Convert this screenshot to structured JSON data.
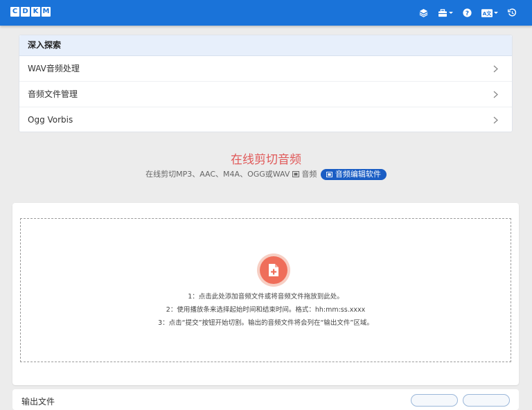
{
  "brand": {
    "letters": [
      "C",
      "D",
      "K",
      "M"
    ]
  },
  "nav": {
    "icons": [
      "layers-icon",
      "toolbox-icon",
      "help-icon",
      "language-icon",
      "history-icon"
    ],
    "language_label": "A文"
  },
  "explore": {
    "title": "深入探索",
    "items": [
      {
        "label": "WAV音频处理"
      },
      {
        "label": "音频文件管理"
      },
      {
        "label": "Ogg Vorbis"
      }
    ]
  },
  "hero": {
    "title": "在线剪切音频",
    "subtitle": "在线剪切MP3、AAC、M4A、OGG或WAV",
    "subtitle_suffix": "音频",
    "pill_label": "音频编辑软件"
  },
  "dropzone": {
    "line1": "1：点击此处添加音频文件或将音频文件拖放到此处。",
    "line2": "2：使用播放条来选择起始时间和结束时间。格式：hh:mm:ss.xxxx",
    "line3": "3：点击“提交”按钮开始切割。输出的音频文件将会列在“输出文件”区域。"
  },
  "output": {
    "title": "输出文件"
  },
  "colors": {
    "topbar": "#1a73d9",
    "hero_title": "#e05858",
    "pill": "#1a5dc4",
    "file_icon": "#ef6e5a"
  }
}
